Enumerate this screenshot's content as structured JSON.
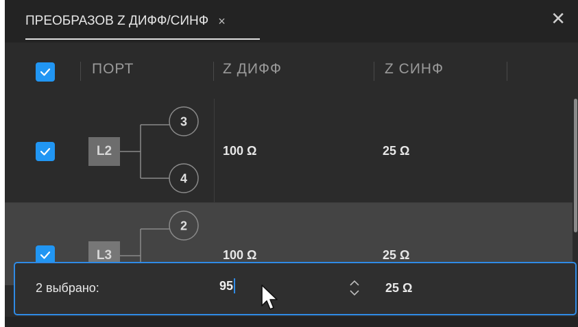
{
  "tab": {
    "title": "ПРЕОБРАЗОВ Z ДИФФ/СИНФ",
    "close_glyph": "×"
  },
  "panel": {
    "close_glyph": "✕"
  },
  "table": {
    "headers": {
      "port": "ПОРТ",
      "z_diff": "Z ДИФФ",
      "z_common": "Z СИНФ"
    },
    "select_all_checked": true,
    "rows": [
      {
        "checked": true,
        "port": "L2",
        "ports": [
          "3",
          "4"
        ],
        "z_diff": "100 Ω",
        "z_common": "25 Ω"
      },
      {
        "checked": true,
        "port": "L3",
        "ports": [
          "2"
        ],
        "z_diff": "100 Ω",
        "z_common": "25 Ω"
      }
    ]
  },
  "edit_bar": {
    "selected_label": "2 выбрано:",
    "z_diff_input": "95",
    "z_common_value": "25 Ω"
  },
  "colors": {
    "accent": "#2196f3",
    "background": "#2b2b2b",
    "selected_row": "#444444"
  }
}
